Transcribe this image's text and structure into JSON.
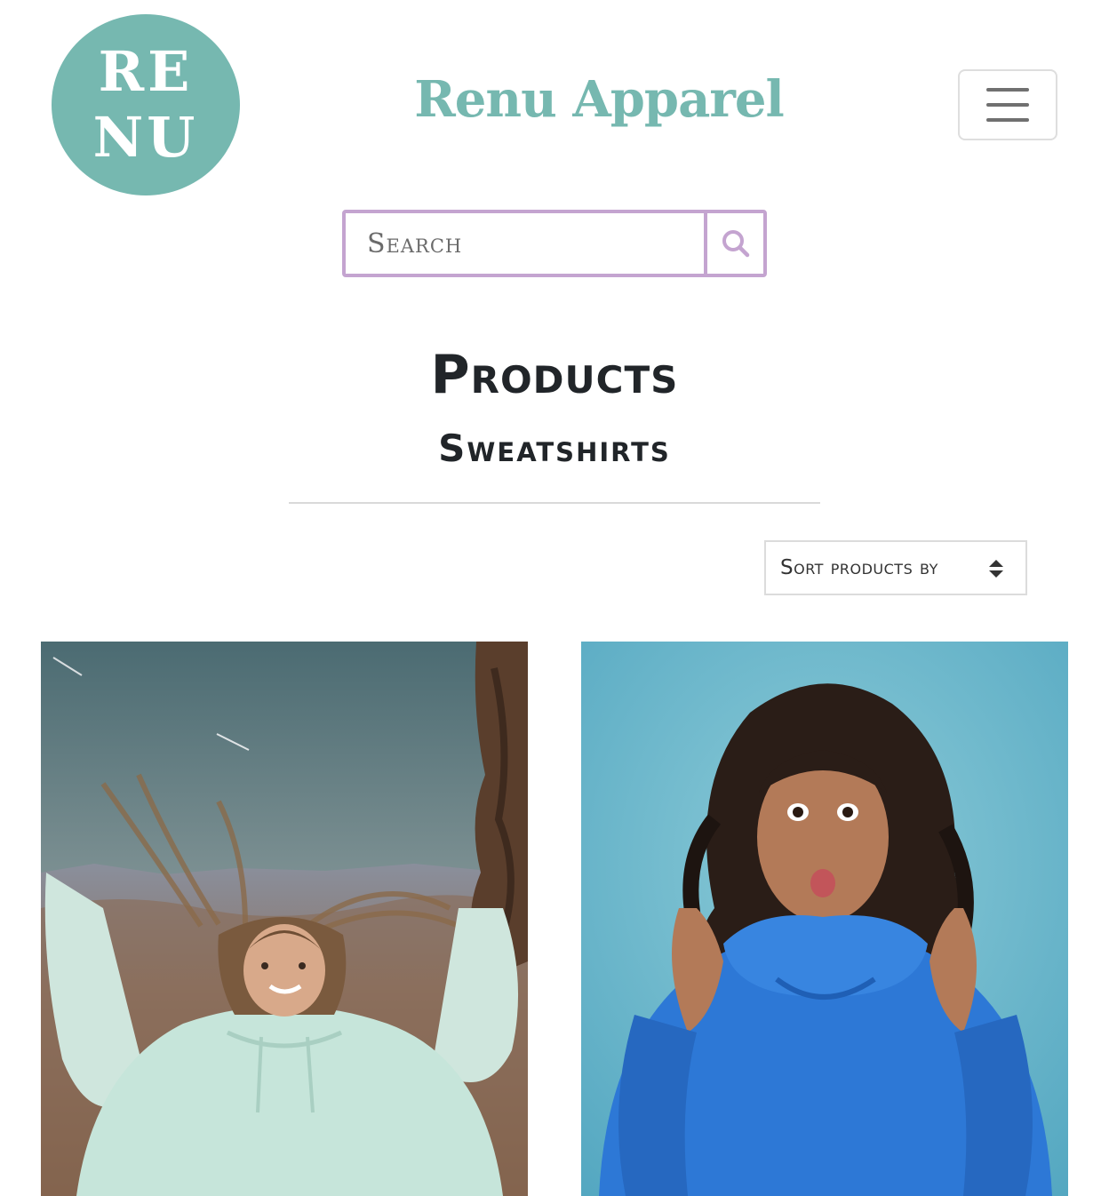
{
  "header": {
    "logo_line1": "RE",
    "logo_line2": "NU",
    "brand_name": "Renu Apparel",
    "menu_icon": "hamburger-menu-icon"
  },
  "search": {
    "placeholder": "Search",
    "icon": "search-icon"
  },
  "main": {
    "title": "Products",
    "category": "Sweatshirts",
    "sort_label": "Sort products by",
    "sort_icon": "sort-arrows-icon"
  },
  "products": [
    {
      "image": "woman in mint hoodie outdoors"
    },
    {
      "image": "woman in blue hoodie"
    }
  ],
  "colors": {
    "brand_teal": "#76b8b0",
    "accent_lavender": "#c4a4d0",
    "text_dark": "#212529"
  }
}
